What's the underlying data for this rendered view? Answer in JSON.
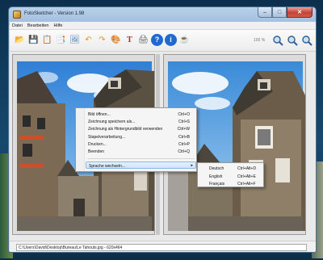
{
  "window": {
    "title": "FotoSketcher - Version 1.98",
    "controls": {
      "minimize": "–",
      "maximize": "□",
      "close": "✕"
    }
  },
  "menubar": [
    "Datei",
    "Bearbeiten",
    "Hilfe"
  ],
  "toolbar": {
    "buttons": [
      {
        "name": "open-icon",
        "glyph": "📂",
        "color": "#4a7fc0"
      },
      {
        "name": "save-icon",
        "glyph": "💾",
        "color": "#3a6aa8"
      },
      {
        "name": "copy-icon",
        "glyph": "📋",
        "color": "#b0452f"
      },
      {
        "name": "paste-icon",
        "glyph": "📑",
        "color": "#8a5ab0"
      },
      {
        "name": "edit-image-icon",
        "glyph": "🖼",
        "color": "#3f7ab8"
      },
      {
        "name": "undo-icon",
        "glyph": "↶",
        "color": "#d89b1a"
      },
      {
        "name": "redo-icon",
        "glyph": "↷",
        "color": "#d89b1a"
      },
      {
        "name": "palette-icon",
        "glyph": "🎨",
        "color": "#c0502a"
      },
      {
        "name": "text-icon",
        "glyph": "T",
        "color": "#b22a2a"
      },
      {
        "name": "print-icon",
        "glyph": "🖨",
        "color": "#555555"
      },
      {
        "name": "help-icon",
        "glyph": "?",
        "color": "#1f6ad0"
      },
      {
        "name": "info-icon",
        "glyph": "i",
        "color": "#1f6ad0"
      },
      {
        "name": "coffee-icon",
        "glyph": "☕",
        "color": "#8a5a30"
      }
    ],
    "zoom_label": "100 %",
    "zoom_buttons": [
      "zoom-in-icon",
      "zoom-out-icon",
      "zoom-fit-icon"
    ]
  },
  "status": {
    "path": "C:\\Users\\David\\Desktop\\Bureau\\Le Tahouts.jpg - 620x464"
  },
  "context_menu": {
    "items": [
      {
        "label": "Bild öffnen...",
        "shortcut": "Ctrl+O"
      },
      {
        "label": "Zeichnung speichern als...",
        "shortcut": "Ctrl+S"
      },
      {
        "label": "Zeichnung als Hintergrundbild verwenden",
        "shortcut": "Ctrl+W"
      },
      {
        "label": "Stapelverarbeitung...",
        "shortcut": "Ctrl+B"
      },
      {
        "label": "Drucken...",
        "shortcut": "Ctrl+P"
      },
      {
        "label": "Beenden",
        "shortcut": "Ctrl+Q"
      }
    ],
    "language_item": {
      "label": "Sprache wechseln...",
      "arrow": "▸"
    }
  },
  "language_submenu": [
    {
      "label": "Deutsch",
      "shortcut": "Ctrl+Alt+D"
    },
    {
      "label": "English",
      "shortcut": "Ctrl+Alt+E"
    },
    {
      "label": "Français",
      "shortcut": "Ctrl+Alt+F"
    }
  ],
  "colors": {
    "accent": "#3399ff",
    "highlight_border": "#8bb6e5",
    "window_frame": "#9fbcdb"
  }
}
